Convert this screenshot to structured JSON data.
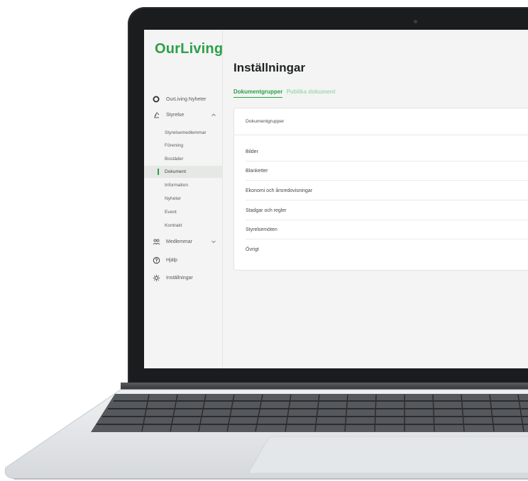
{
  "app": {
    "logo": "OurLiving"
  },
  "sidebar": {
    "items": [
      {
        "label": "OurLiving Nyheter",
        "icon": "circle-logo-icon"
      },
      {
        "label": "Styrelse",
        "icon": "gavel-icon",
        "expanded": true
      },
      {
        "label": "Medlemmar",
        "icon": "users-icon",
        "expanded": false
      },
      {
        "label": "Hjälp",
        "icon": "help-circle-icon"
      },
      {
        "label": "Inställningar",
        "icon": "gear-icon"
      }
    ],
    "styrelse_subitems": [
      "Styrelsemedlemmar",
      "Förening",
      "Bostäder",
      "Dokument",
      "Information",
      "Nyheter",
      "Event",
      "Kontrakt"
    ],
    "active_subitem": "Dokument"
  },
  "main": {
    "title": "Inställningar",
    "tabs": [
      {
        "label": "Dokumentgrupper",
        "active": true
      },
      {
        "label": "Publika dokument",
        "active": false
      }
    ],
    "card": {
      "header": "Dokumentgrupper",
      "rows": [
        "Bilder",
        "Blanketter",
        "Ekonomi och årsredovisningar",
        "Stadgar och regler",
        "Styrelsemöten",
        "Övrigt"
      ]
    }
  },
  "colors": {
    "accent": "#2aa04a",
    "accent_light": "#a5d7b1",
    "screen_bg": "#f3f4f3",
    "card_bg": "#ffffff",
    "bezel": "#1b1c1e"
  }
}
